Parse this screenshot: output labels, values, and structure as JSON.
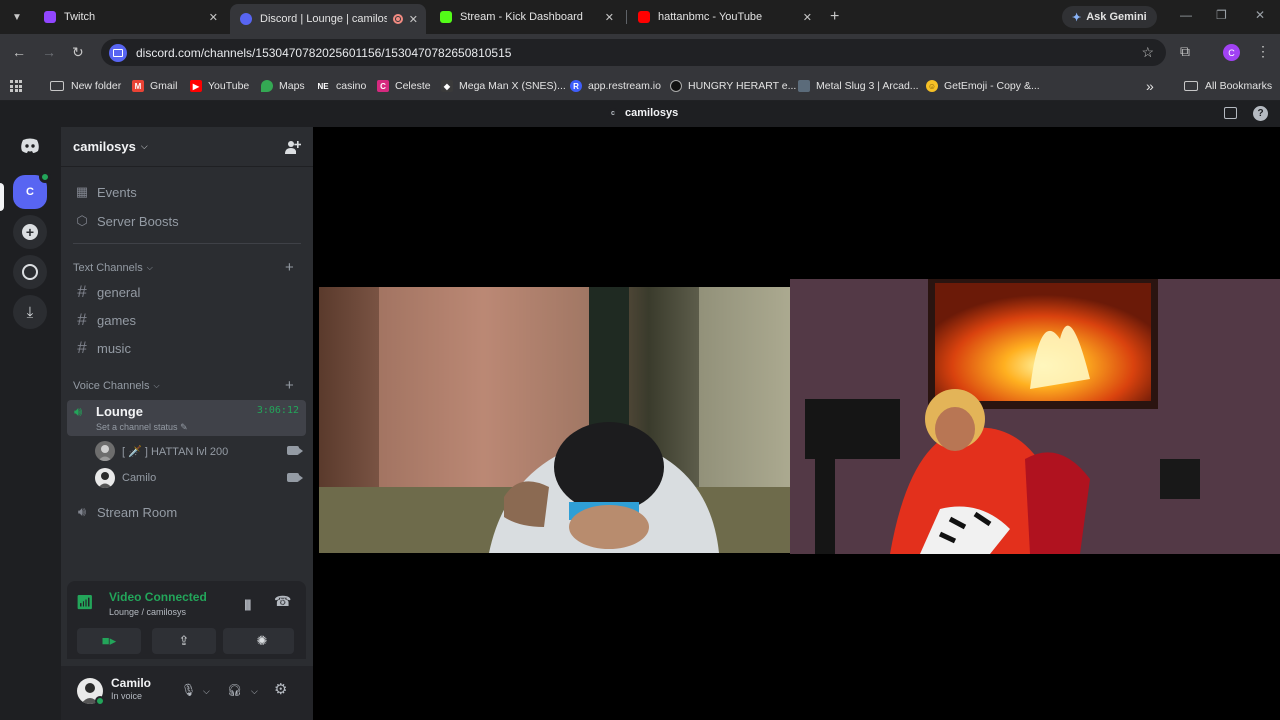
{
  "browser": {
    "tabs": [
      {
        "title": "Twitch",
        "favicon_color": "#9146ff"
      },
      {
        "title": "Discord | Lounge | camilosys",
        "favicon_color": "#5865f2"
      },
      {
        "title": "Stream - Kick Dashboard",
        "favicon_color": "#53fc18"
      },
      {
        "title": "hattanbmc - YouTube",
        "favicon_color": "#ff0000"
      }
    ],
    "gemini_label": "Ask Gemini",
    "url": "discord.com/channels/1530470782025601156/1530470782650810515",
    "profile_initial": "C",
    "bookmarks": [
      {
        "label": "New folder",
        "icon": "folder-icon"
      },
      {
        "label": "Gmail",
        "icon": "gmail-icon"
      },
      {
        "label": "YouTube",
        "icon": "youtube-icon"
      },
      {
        "label": "Maps",
        "icon": "maps-icon"
      },
      {
        "label": "casino",
        "icon": "ne-icon"
      },
      {
        "label": "Celeste",
        "icon": "celeste-icon"
      },
      {
        "label": "Mega Man X (SNES)...",
        "icon": "megaman-icon"
      },
      {
        "label": "app.restream.io",
        "icon": "restream-icon"
      },
      {
        "label": "HUNGRY HERART e...",
        "icon": "hungry-icon"
      },
      {
        "label": "Metal Slug 3 | Arcad...",
        "icon": "metalslug-icon"
      },
      {
        "label": "GetEmoji - Copy &...",
        "icon": "emoji-icon"
      }
    ],
    "bookmarks_more": "»",
    "all_bookmarks": "All Bookmarks"
  },
  "discord": {
    "title_server": "camilosys",
    "title_initial": "c",
    "rail": {
      "server_initial": "C"
    },
    "server": {
      "name": "camilosys"
    },
    "nav": [
      {
        "label": "Events",
        "icon": "calendar-icon"
      },
      {
        "label": "Server Boosts",
        "icon": "boost-icon"
      }
    ],
    "text_category": "Text Channels",
    "text_channels": [
      "general",
      "games",
      "music"
    ],
    "voice_category": "Voice Channels",
    "active_voice": {
      "name": "Lounge",
      "timer": "3:06:12",
      "status": "Set a channel status"
    },
    "voice_users": [
      {
        "name": "[ 🗡️ ] HATTAN lvl 200"
      },
      {
        "name": "Camilo"
      }
    ],
    "other_voice": "Stream Room",
    "voice_panel": {
      "status": "Video Connected",
      "location": "Lounge / camilosys"
    },
    "user": {
      "name": "Camilo",
      "status": "In voice"
    },
    "accent": "#5865f2",
    "online_color": "#23a55a"
  }
}
